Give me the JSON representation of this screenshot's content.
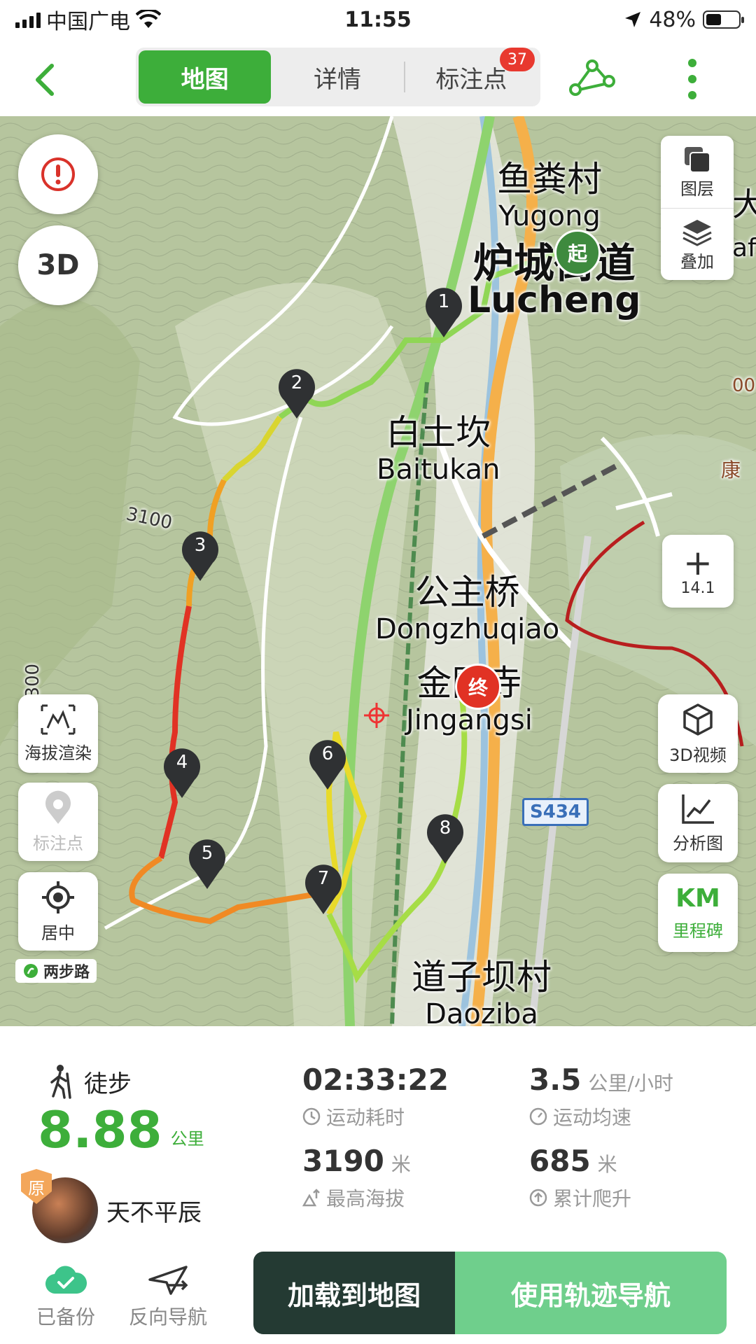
{
  "status_bar": {
    "carrier": "中国广电",
    "time": "11:55",
    "battery": "48%",
    "battery_level": 0.48
  },
  "header": {
    "tabs": [
      {
        "label": "地图",
        "active": true
      },
      {
        "label": "详情",
        "active": false
      },
      {
        "label": "标注点",
        "active": false,
        "badge": "37"
      }
    ],
    "accent_color": "#3dae3a"
  },
  "map": {
    "places": [
      {
        "cn": "鱼粪村",
        "en": "Yugong"
      },
      {
        "cn": "炉城街道",
        "en": "Lucheng"
      },
      {
        "cn": "白土坎",
        "en": "Baitukan"
      },
      {
        "cn": "公主桥",
        "en": "Dongzhuqiao"
      },
      {
        "cn": "金刚寺",
        "en": "Jingangsi"
      },
      {
        "cn": "道子坝村",
        "en": "Daoziba"
      }
    ],
    "contour_labels": [
      "3100",
      "3300"
    ],
    "edge_labels": [
      "大",
      "af",
      "康",
      "00"
    ],
    "road_shield": "S434",
    "start_label": "起",
    "end_label": "终",
    "waypoints": [
      "1",
      "2",
      "3",
      "4",
      "5",
      "6",
      "7",
      "8"
    ],
    "brand": "两步路",
    "controls": {
      "layers": "图层",
      "overlay": "叠加",
      "zoom_level": "14.1",
      "three_d": "3D",
      "elevation_render": "海拔渲染",
      "markers": "标注点",
      "center": "居中",
      "video_3d": "3D视频",
      "analysis": "分析图",
      "milestone_km": "KM",
      "milestone": "里程碑"
    }
  },
  "stats": {
    "sport": "徒步",
    "distance": "8.88",
    "distance_unit": "公里",
    "user_name": "天不平辰",
    "original_badge": "原",
    "duration": "02:33:22",
    "duration_label": "运动耗时",
    "avg_speed": "3.5",
    "avg_speed_unit": "公里/小时",
    "avg_speed_label": "运动均速",
    "max_altitude": "3190",
    "max_altitude_unit": "米",
    "max_altitude_label": "最高海拔",
    "climb": "685",
    "climb_unit": "米",
    "climb_label": "累计爬升"
  },
  "bottom": {
    "backed_up": "已备份",
    "reverse_nav": "反向导航",
    "load_to_map": "加载到地图",
    "use_track_nav": "使用轨迹导航"
  }
}
